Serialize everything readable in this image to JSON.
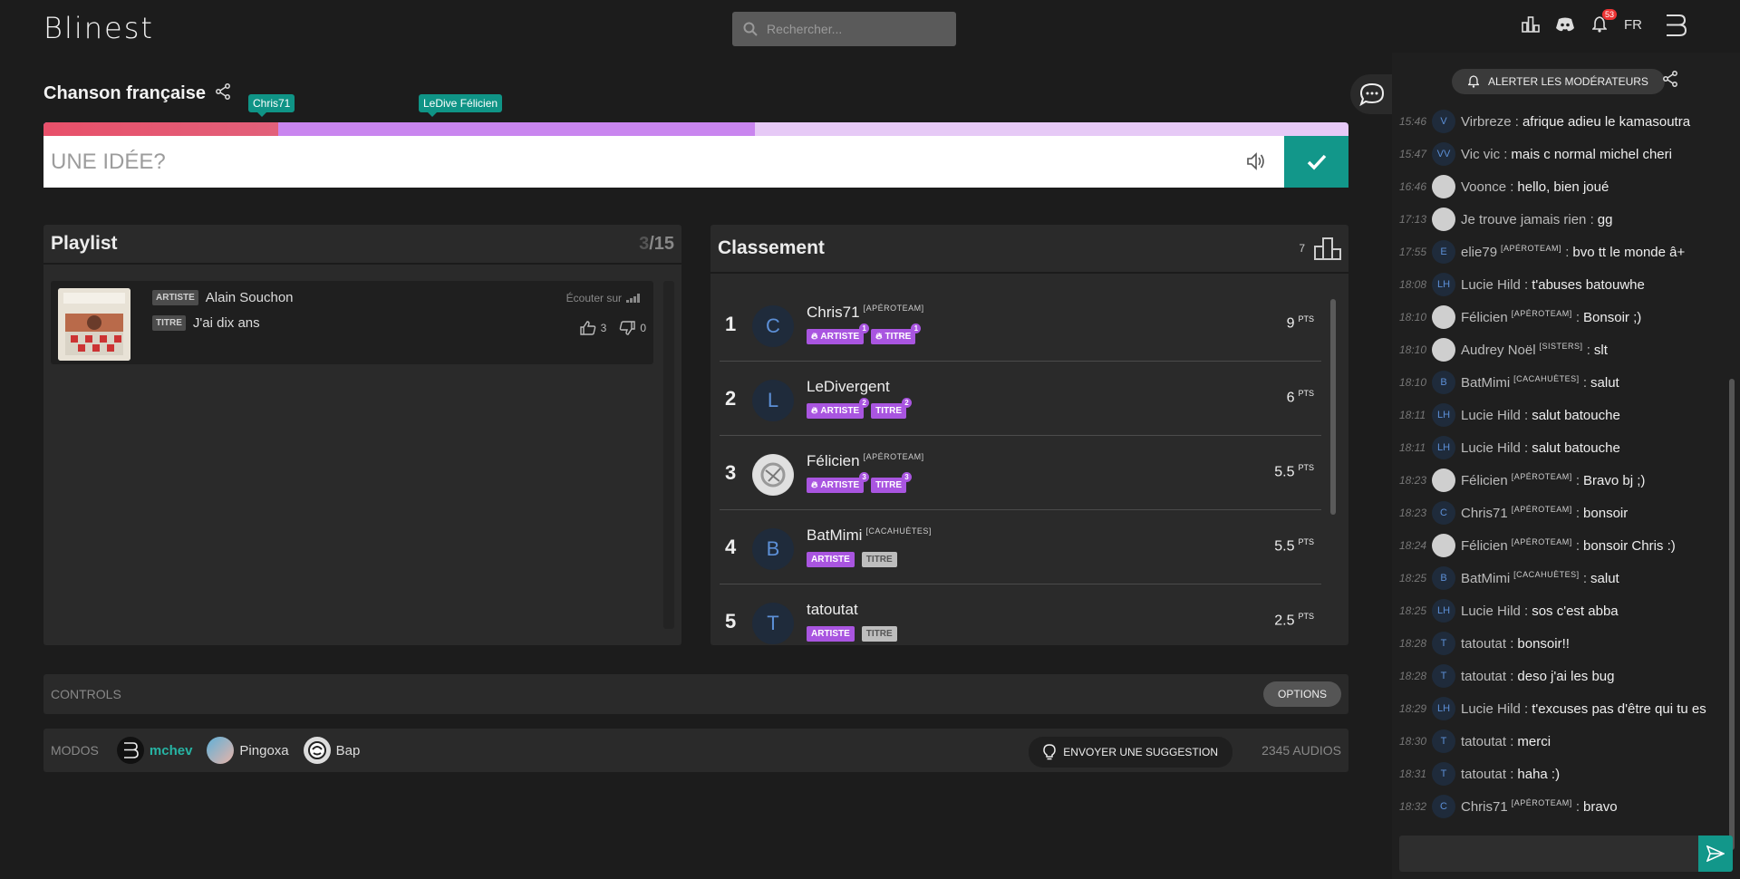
{
  "app": {
    "logo": "Blinest",
    "lang": "FR",
    "notif_count": "53"
  },
  "search": {
    "placeholder": "Rechercher..."
  },
  "room": {
    "title": "Chanson française"
  },
  "tags": [
    {
      "label": "Chris71"
    },
    {
      "label": "LeDive Félicien"
    }
  ],
  "progress": {
    "artist_found": 0.18,
    "title_found": 0.545
  },
  "guess": {
    "placeholder": "UNE IDÉE?"
  },
  "playlist": {
    "title": "Playlist",
    "current": "3",
    "total": "/15",
    "item": {
      "artist_label": "ARTISTE",
      "artist": "Alain Souchon",
      "title_label": "TITRE",
      "title": "J'ai dix ans",
      "listen": "Écouter sur",
      "likes": "3",
      "dislikes": "0"
    }
  },
  "ranking": {
    "title": "Classement",
    "count": "7",
    "rows": [
      {
        "rank": "1",
        "initial": "C",
        "name": "Chris71",
        "team": "[APÉROTEAM]",
        "artist": "ARTISTE",
        "artist_pos": "1",
        "title": "TITRE",
        "title_pos": "1",
        "pts": "9",
        "unit": "PTS"
      },
      {
        "rank": "2",
        "initial": "L",
        "name": "LeDivergent",
        "team": "",
        "artist": "ARTISTE",
        "artist_pos": "2",
        "title": "TITRE",
        "title_pos": "2",
        "pts": "6",
        "unit": "PTS"
      },
      {
        "rank": "3",
        "initial": "",
        "name": "Félicien",
        "team": "[APÉROTEAM]",
        "artist": "ARTISTE",
        "artist_pos": "3",
        "title": "TITRE",
        "title_pos": "3",
        "pts": "5.5",
        "unit": "PTS"
      },
      {
        "rank": "4",
        "initial": "B",
        "name": "BatMimi",
        "team": "[CACAHUÈTES]",
        "artist": "ARTISTE",
        "artist_pos": "",
        "title": "TITRE",
        "title_pos": "",
        "pts": "5.5",
        "unit": "PTS"
      },
      {
        "rank": "5",
        "initial": "T",
        "name": "tatoutat",
        "team": "",
        "artist": "ARTISTE",
        "artist_pos": "",
        "title": "TITRE",
        "title_pos": "",
        "pts": "2.5",
        "unit": "PTS"
      }
    ]
  },
  "controls": {
    "label": "CONTROLS",
    "options": "OPTIONS"
  },
  "modos": {
    "label": "MODOS",
    "list": [
      "mchev",
      "Pingoxa",
      "Bap"
    ],
    "suggest": "ENVOYER UNE SUGGESTION",
    "audios": "2345 AUDIOS"
  },
  "chat": {
    "alert": "ALERTER LES MODÉRATEURS",
    "messages": [
      {
        "t": "15:46",
        "av": "V",
        "user": "Virbreze",
        "team": "",
        "text": "afrique adieu le kamasoutra"
      },
      {
        "t": "15:47",
        "av": "VV",
        "user": "Vic vic",
        "team": "",
        "text": "mais c normal michel cheri"
      },
      {
        "t": "16:46",
        "av": "",
        "user": "Voonce",
        "team": "",
        "text": "hello, bien joué"
      },
      {
        "t": "17:13",
        "av": "",
        "user": "Je trouve jamais rien",
        "team": "",
        "text": "gg"
      },
      {
        "t": "17:55",
        "av": "E",
        "user": "elie79",
        "team": "[APÉROTEAM]",
        "text": "bvo tt le monde â+"
      },
      {
        "t": "18:08",
        "av": "LH",
        "user": "Lucie Hild",
        "team": "",
        "text": "t'abuses batouwhe"
      },
      {
        "t": "18:10",
        "av": "",
        "user": "Félicien",
        "team": "[APÉROTEAM]",
        "text": "Bonsoir ;)"
      },
      {
        "t": "18:10",
        "av": "",
        "user": "Audrey Noël",
        "team": "[SISTERS]",
        "text": "slt"
      },
      {
        "t": "18:10",
        "av": "B",
        "user": "BatMimi",
        "team": "[CACAHUÈTES]",
        "text": "salut"
      },
      {
        "t": "18:11",
        "av": "LH",
        "user": "Lucie Hild",
        "team": "",
        "text": "salut batouche"
      },
      {
        "t": "18:11",
        "av": "LH",
        "user": "Lucie Hild",
        "team": "",
        "text": "salut batouche"
      },
      {
        "t": "18:23",
        "av": "",
        "user": "Félicien",
        "team": "[APÉROTEAM]",
        "text": "Bravo bj ;)"
      },
      {
        "t": "18:23",
        "av": "C",
        "user": "Chris71",
        "team": "[APÉROTEAM]",
        "text": "bonsoir"
      },
      {
        "t": "18:24",
        "av": "",
        "user": "Félicien",
        "team": "[APÉROTEAM]",
        "text": "bonsoir Chris :)"
      },
      {
        "t": "18:25",
        "av": "B",
        "user": "BatMimi",
        "team": "[CACAHUÈTES]",
        "text": "salut"
      },
      {
        "t": "18:25",
        "av": "LH",
        "user": "Lucie Hild",
        "team": "",
        "text": "sos c'est abba"
      },
      {
        "t": "18:28",
        "av": "T",
        "user": "tatoutat",
        "team": "",
        "text": "bonsoir!!"
      },
      {
        "t": "18:28",
        "av": "T",
        "user": "tatoutat",
        "team": "",
        "text": "deso j'ai les bug"
      },
      {
        "t": "18:29",
        "av": "LH",
        "user": "Lucie Hild",
        "team": "",
        "text": "t'excuses pas d'être qui tu es"
      },
      {
        "t": "18:30",
        "av": "T",
        "user": "tatoutat",
        "team": "",
        "text": "merci"
      },
      {
        "t": "18:31",
        "av": "T",
        "user": "tatoutat",
        "team": "",
        "text": "haha :)"
      },
      {
        "t": "18:32",
        "av": "C",
        "user": "Chris71",
        "team": "[APÉROTEAM]",
        "text": "bravo"
      }
    ]
  }
}
